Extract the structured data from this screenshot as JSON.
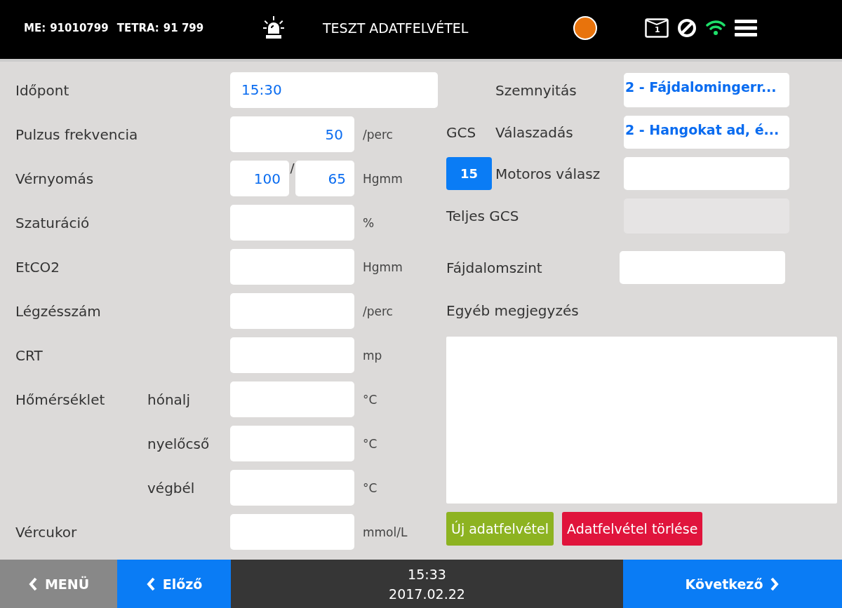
{
  "header": {
    "unit_label": "ME:",
    "unit_value": "91010799",
    "tetra_label": "TETRA:",
    "tetra_value": "91 799",
    "title": "TESZT ADATFELVÉTEL",
    "status_lights": [
      {
        "color": "#e8730c"
      }
    ],
    "mail_count": "1",
    "wifi_connected": true
  },
  "vitals": [
    {
      "kind": "wide",
      "label": "Időpont",
      "value": "15:30"
    },
    {
      "kind": "single",
      "label": "Pulzus frekvencia",
      "value": "50",
      "unit": "/perc"
    },
    {
      "kind": "pair",
      "label": "Vérnyomás",
      "values": [
        "100",
        "65"
      ],
      "separator": "/",
      "unit": "Hgmm"
    },
    {
      "kind": "single",
      "label": "Szaturáció",
      "unit": "%"
    },
    {
      "kind": "single",
      "label": "EtCO2",
      "unit": "Hgmm"
    },
    {
      "kind": "single",
      "label": "Légzésszám",
      "unit": "/perc"
    },
    {
      "kind": "single",
      "label": "CRT",
      "unit": "mp"
    },
    {
      "kind": "single",
      "label": "Hőmérséklet",
      "sublabel": "hónalj",
      "unit": "°C"
    },
    {
      "kind": "single",
      "sublabel": "nyelőcső",
      "unit": "°C"
    },
    {
      "kind": "single",
      "sublabel": "végbél",
      "unit": "°C"
    },
    {
      "kind": "single",
      "label": "Vércukor",
      "unit": "mmol/L"
    }
  ],
  "gcs": {
    "label": "GCS",
    "score": "15",
    "items": [
      {
        "label": "Szemnyitás",
        "value": "2 - Fájdalomingerr..."
      },
      {
        "label": "Válaszadás",
        "value": "2 - Hangokat ad, é..."
      },
      {
        "label": "Motoros válasz"
      }
    ],
    "total": {
      "label": "Teljes GCS",
      "disabled": true
    }
  },
  "pain": {
    "label": "Fájdalomszint"
  },
  "note": {
    "label": "Egyéb megjegyzés"
  },
  "actions": [
    {
      "kind": "confirm",
      "label": "Új adatfelvétel"
    },
    {
      "kind": "danger",
      "label": "Adatfelvétel törlése"
    }
  ],
  "footer": {
    "menu": "MENÜ",
    "prev": "Előző",
    "time": "15:33",
    "date": "2017.02.22",
    "next": "Következő"
  }
}
